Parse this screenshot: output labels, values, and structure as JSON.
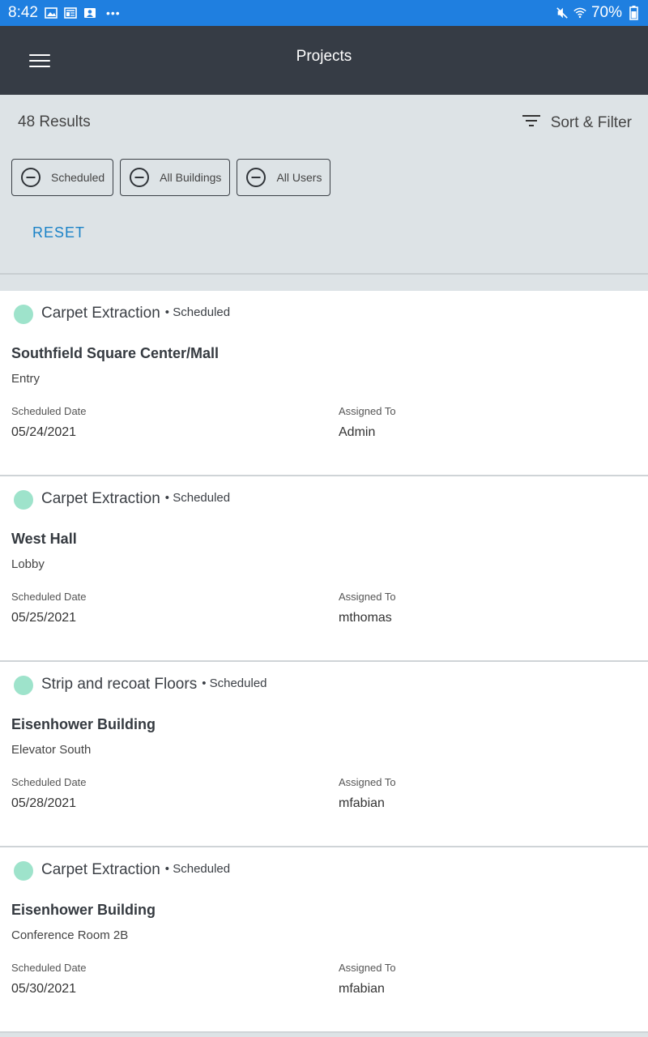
{
  "status_bar": {
    "time": "8:42",
    "battery": "70%",
    "icons": [
      "image-icon",
      "news-icon",
      "contact-icon",
      "more-icon",
      "mute-icon",
      "wifi-icon",
      "battery-icon"
    ]
  },
  "app_bar": {
    "title": "Projects",
    "menu_icon": "hamburger-menu-icon"
  },
  "filters": {
    "results_count": "48 Results",
    "sort_filter_label": "Sort & Filter",
    "chips": [
      {
        "label": "Scheduled"
      },
      {
        "label": "All Buildings"
      },
      {
        "label": "All Users"
      }
    ],
    "reset_label": "RESET"
  },
  "labels": {
    "scheduled_date": "Scheduled Date",
    "assigned_to": "Assigned To"
  },
  "colors": {
    "status_bar": "#1f7fe0",
    "app_bar": "#363c45",
    "accent_link": "#1a82c7",
    "status_dot": "#9ee3cb",
    "filter_background": "#dde3e6"
  },
  "projects": [
    {
      "type": "Carpet Extraction",
      "status": "• Scheduled",
      "building": "Southfield Square Center/Mall",
      "location": "Entry",
      "date": "05/24/2021",
      "assigned_to": "Admin"
    },
    {
      "type": "Carpet Extraction",
      "status": "• Scheduled",
      "building": "West Hall",
      "location": "Lobby",
      "date": "05/25/2021",
      "assigned_to": "mthomas"
    },
    {
      "type": "Strip and recoat Floors",
      "status": "• Scheduled",
      "building": "Eisenhower Building",
      "location": "Elevator South",
      "date": "05/28/2021",
      "assigned_to": "mfabian"
    },
    {
      "type": "Carpet Extraction",
      "status": "• Scheduled",
      "building": "Eisenhower Building",
      "location": "Conference Room 2B",
      "date": "05/30/2021",
      "assigned_to": "mfabian"
    }
  ]
}
